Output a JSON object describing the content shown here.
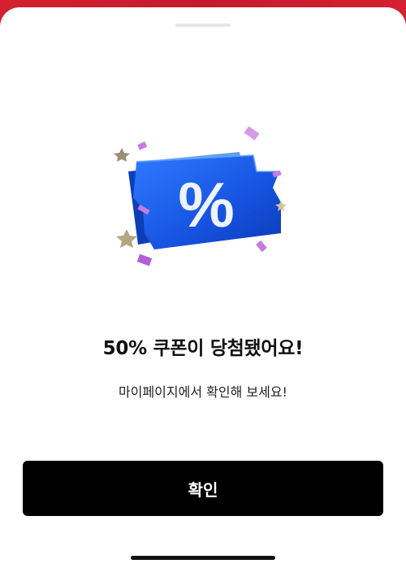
{
  "dialog": {
    "title": "50% 쿠폰이 당첨됐어요!",
    "message": "마이페이지에서 확인해 보세요!",
    "confirm_label": "확인",
    "coupon_symbol": "%"
  },
  "icons": {
    "illustration": "coupon-ticket-icon",
    "confetti": "confetti-icon",
    "star": "star-icon"
  },
  "colors": {
    "background_top": "#c51b2c",
    "ticket_blue": "#1a5ee8",
    "button": "#000000",
    "confetti": "#c67be0"
  }
}
